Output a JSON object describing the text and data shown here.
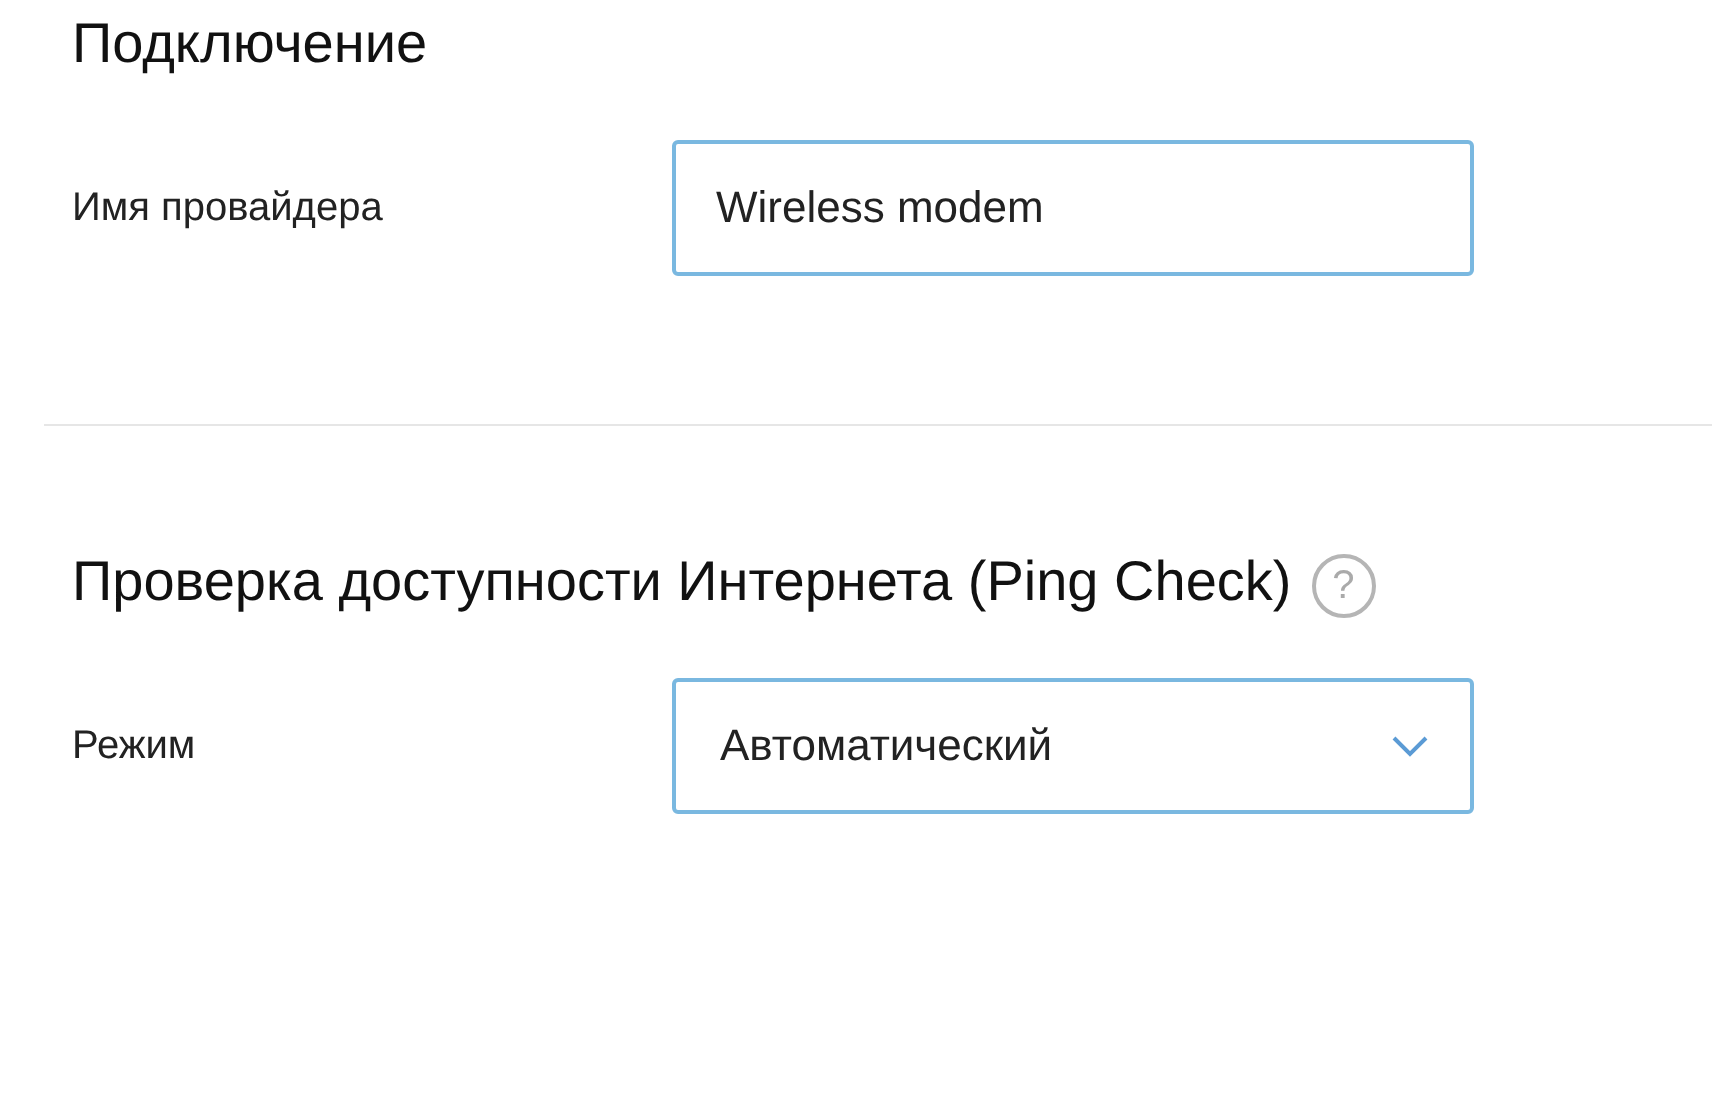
{
  "sections": [
    {
      "title": "Подключение",
      "help": false,
      "fields": [
        {
          "label": "Имя провайдера",
          "kind": "input",
          "value": "Wireless modem"
        }
      ]
    },
    {
      "title": "Проверка доступности Интернета (Ping Check)",
      "help": true,
      "help_icon": "?",
      "fields": [
        {
          "label": "Режим",
          "kind": "select",
          "value": "Автоматический"
        }
      ]
    }
  ]
}
